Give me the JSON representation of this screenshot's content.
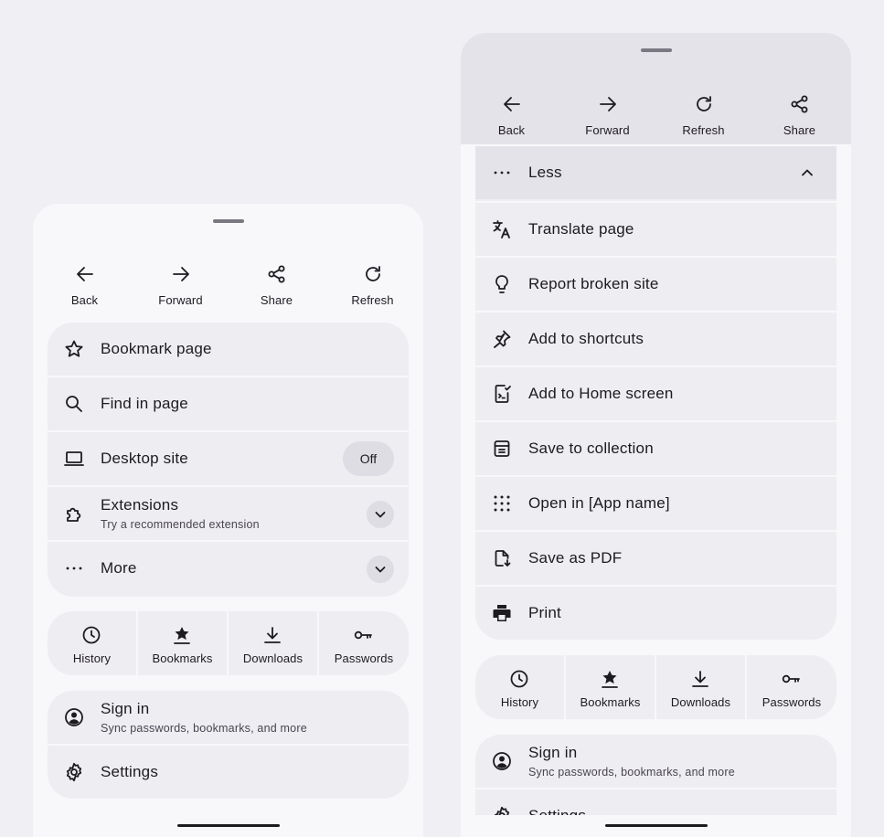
{
  "left_menu": {
    "nav": [
      {
        "label": "Back",
        "icon": "arrow-back-icon"
      },
      {
        "label": "Forward",
        "icon": "arrow-forward-icon"
      },
      {
        "label": "Share",
        "icon": "share-icon"
      },
      {
        "label": "Refresh",
        "icon": "refresh-icon"
      }
    ],
    "items": {
      "bookmark": {
        "label": "Bookmark page",
        "icon": "star-icon"
      },
      "find": {
        "label": "Find in page",
        "icon": "search-icon"
      },
      "desktop": {
        "label": "Desktop site",
        "icon": "laptop-icon",
        "toggle": "Off"
      },
      "extensions": {
        "label": "Extensions",
        "sub": "Try a recommended extension",
        "icon": "puzzle-icon"
      },
      "more": {
        "label": "More",
        "icon": "more-horizontal-icon"
      }
    },
    "tiles": [
      {
        "label": "History",
        "icon": "clock-icon"
      },
      {
        "label": "Bookmarks",
        "icon": "bookmark-star-icon"
      },
      {
        "label": "Downloads",
        "icon": "download-icon"
      },
      {
        "label": "Passwords",
        "icon": "key-icon"
      }
    ],
    "account": {
      "signin": {
        "label": "Sign in",
        "sub": "Sync passwords, bookmarks, and more",
        "icon": "account-circle-icon"
      },
      "settings": {
        "label": "Settings",
        "icon": "gear-icon"
      }
    }
  },
  "right_menu": {
    "nav": [
      {
        "label": "Back",
        "icon": "arrow-back-icon"
      },
      {
        "label": "Forward",
        "icon": "arrow-forward-icon"
      },
      {
        "label": "Refresh",
        "icon": "refresh-icon"
      },
      {
        "label": "Share",
        "icon": "share-icon"
      }
    ],
    "items": {
      "less": {
        "label": "Less",
        "icon": "more-horizontal-icon"
      },
      "translate": {
        "label": "Translate page",
        "icon": "translate-icon"
      },
      "report": {
        "label": "Report broken site",
        "icon": "lightbulb-icon"
      },
      "shortcuts": {
        "label": "Add to shortcuts",
        "icon": "pin-icon"
      },
      "homescreen": {
        "label": "Add to Home screen",
        "icon": "add-home-icon"
      },
      "collection": {
        "label": "Save to collection",
        "icon": "collection-icon"
      },
      "openin": {
        "label": "Open in [App name]",
        "icon": "apps-grid-icon"
      },
      "pdf": {
        "label": "Save as PDF",
        "icon": "pdf-save-icon"
      },
      "print": {
        "label": "Print",
        "icon": "printer-icon"
      }
    },
    "tiles": [
      {
        "label": "History",
        "icon": "clock-icon"
      },
      {
        "label": "Bookmarks",
        "icon": "bookmark-star-icon"
      },
      {
        "label": "Downloads",
        "icon": "download-icon"
      },
      {
        "label": "Passwords",
        "icon": "key-icon"
      }
    ],
    "account": {
      "signin": {
        "label": "Sign in",
        "sub": "Sync passwords, bookmarks, and more",
        "icon": "account-circle-icon"
      },
      "settings": {
        "label": "Settings",
        "icon": "gear-icon"
      }
    }
  }
}
